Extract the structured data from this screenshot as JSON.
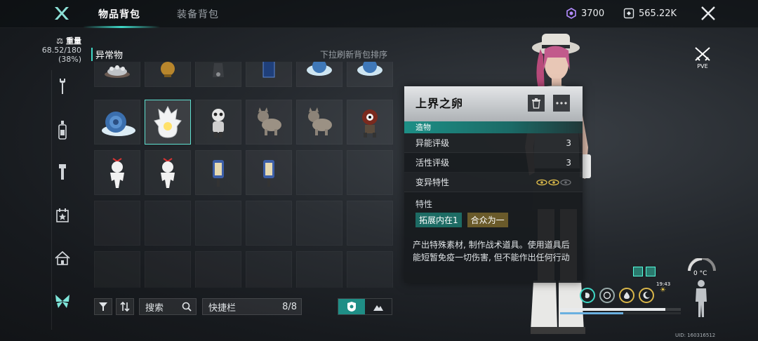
{
  "tabs": {
    "items": "物品背包",
    "equipment": "装备背包"
  },
  "currency": {
    "crystal": "3700",
    "coins": "565.22K"
  },
  "weight": {
    "label": "重量",
    "value": "68.52/180",
    "percent": "(38%)"
  },
  "category": {
    "title": "异常物",
    "refresh_hint": "下拉刷新背包排序"
  },
  "toolbar": {
    "search_placeholder": "搜索",
    "quickbar_label": "快捷栏",
    "quickbar_count": "8/8"
  },
  "detail": {
    "title": "上界之卵",
    "type": "造物",
    "rows": [
      {
        "label": "异能评级",
        "value": "3"
      },
      {
        "label": "活性评级",
        "value": "3"
      },
      {
        "label": "变异特性",
        "value": ""
      }
    ],
    "traits_label": "特性",
    "traits": [
      "拓展内在1",
      "合众为一"
    ],
    "description": "产出特殊素材, 制作战术道具。使用道具后能短暂免疫一切伤害, 但不能作出任何行动"
  },
  "side": {
    "pve": "PVE",
    "temperature": "0 °C",
    "time": "19:43",
    "uid": "UID: 160316512"
  },
  "colors": {
    "accent": "#3fd7c6",
    "selected_border": "#5fe0d0",
    "trait1": "#1d6b64",
    "trait2": "#6a5a2a"
  },
  "nav_icons": [
    "wrench-icon",
    "bottle-icon",
    "tool-icon",
    "calendar-star-icon",
    "home-icon",
    "butterfly-icon"
  ]
}
